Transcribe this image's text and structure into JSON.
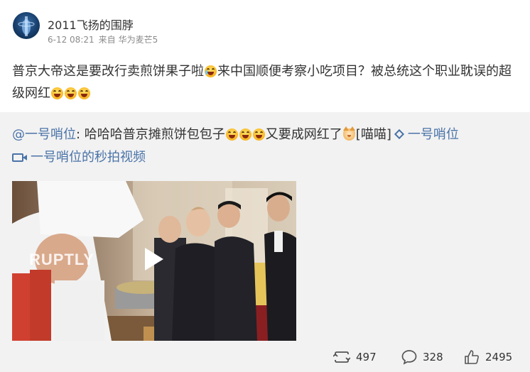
{
  "post": {
    "author": "2011飞扬的围脖",
    "time": "6-12 08:21",
    "source_prefix": "来自",
    "source": "华为麦芒5",
    "text_part1": "普京大帝这是要改行卖煎饼果子啦",
    "text_part2": "来中国顺便考察小吃项目？被总统这个职业耽误的超级网红"
  },
  "repost": {
    "mention": "@一号哨位",
    "text_part1": ": 哈哈哈普京摊煎饼包包子",
    "text_part2": "又要成网红了",
    "emoji_text": "[喵喵]",
    "topic_link": "一号哨位",
    "video_link": "一号哨位的秒拍视频",
    "watermark": "RUPTLY"
  },
  "actions": {
    "repost_count": "497",
    "comment_count": "328",
    "like_count": "2495"
  },
  "icons": {
    "avatar": "avatar",
    "play": "play-icon",
    "repost": "repost-icon",
    "comment": "comment-icon",
    "like": "thumbs-up-icon",
    "video_link": "video-icon",
    "topic": "diamond-icon"
  },
  "colors": {
    "link": "#4a73a8",
    "repost_bg": "#f2f2f2"
  }
}
